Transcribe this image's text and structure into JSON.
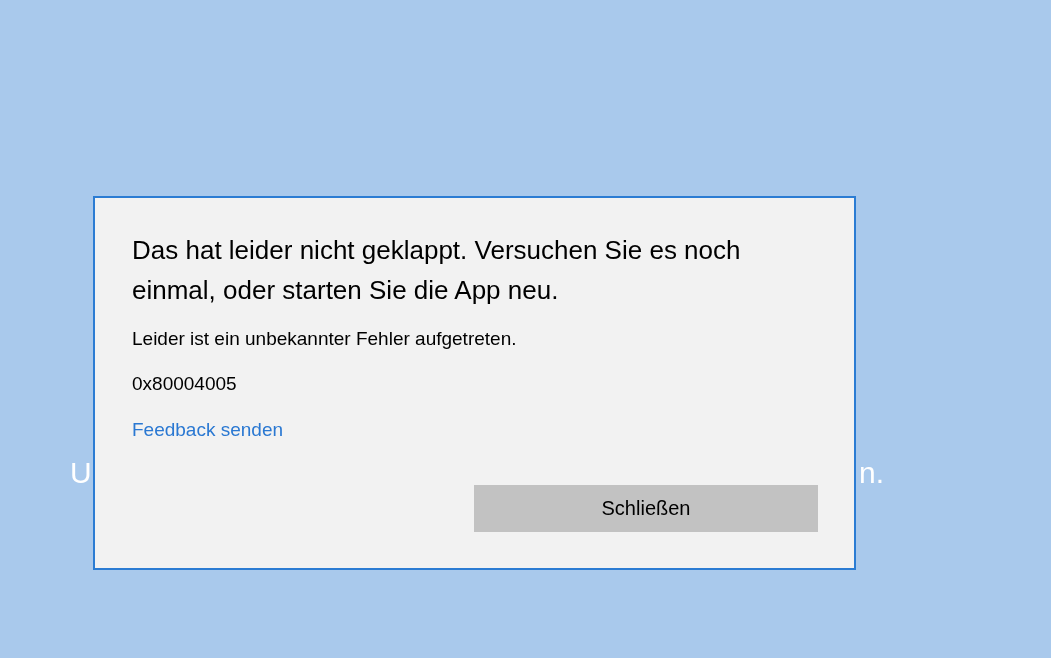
{
  "background_text": [
    {
      "text": "U"
    },
    {
      "text": "n."
    }
  ],
  "dialog": {
    "title": "Das hat leider nicht geklappt. Versuchen Sie es noch einmal, oder starten Sie die App neu.",
    "message": "Leider ist ein unbekannter Fehler aufgetreten.",
    "error_code": "0x80004005",
    "link": "Feedback senden",
    "buttons": [
      "Schließen"
    ]
  }
}
